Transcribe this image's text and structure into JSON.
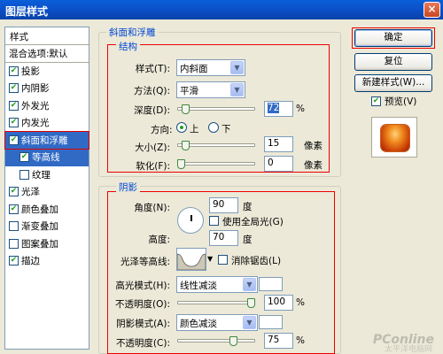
{
  "window": {
    "title": "图层样式",
    "close_glyph": "×"
  },
  "left_panel": {
    "header": "样式",
    "blend_item": "混合选项:默认",
    "items": [
      {
        "label": "投影",
        "checked": true
      },
      {
        "label": "内阴影",
        "checked": true
      },
      {
        "label": "外发光",
        "checked": true
      },
      {
        "label": "内发光",
        "checked": true
      },
      {
        "label": "斜面和浮雕",
        "checked": true,
        "selected": true
      },
      {
        "label": "等高线",
        "checked": true,
        "sub": true
      },
      {
        "label": "纹理",
        "checked": false,
        "sub": true
      },
      {
        "label": "光泽",
        "checked": true
      },
      {
        "label": "颜色叠加",
        "checked": true
      },
      {
        "label": "渐变叠加",
        "checked": false
      },
      {
        "label": "图案叠加",
        "checked": false
      },
      {
        "label": "描边",
        "checked": true
      }
    ]
  },
  "bevel": {
    "group_title": "斜面和浮雕",
    "structure_title": "结构",
    "style_label": "样式(T):",
    "style_value": "内斜面",
    "technique_label": "方法(Q):",
    "technique_value": "平滑",
    "depth_label": "深度(D):",
    "depth_value": "72",
    "depth_unit": "%",
    "direction_label": "方向:",
    "direction_up": "上",
    "direction_down": "下",
    "size_label": "大小(Z):",
    "size_value": "15",
    "size_unit": "像素",
    "soften_label": "软化(F):",
    "soften_value": "0",
    "soften_unit": "像素",
    "depth_level": 0.06,
    "size_level": 0.06,
    "soften_level": 0.0
  },
  "shading": {
    "group_title": "阴影",
    "angle_label": "角度(N):",
    "angle_value": "90",
    "angle_unit": "度",
    "global_light_label": "使用全局光(G)",
    "altitude_label": "高度:",
    "altitude_value": "70",
    "altitude_unit": "度",
    "gloss_label": "光泽等高线:",
    "antialias_label": "消除锯齿(L)",
    "highlight_mode_label": "高光模式(H):",
    "highlight_mode_value": "线性减淡",
    "highlight_opacity_label": "不透明度(O):",
    "highlight_opacity_value": "100",
    "highlight_opacity_unit": "%",
    "shadow_mode_label": "阴影模式(A):",
    "shadow_mode_value": "颜色减淡",
    "shadow_opacity_label": "不透明度(C):",
    "shadow_opacity_value": "75",
    "shadow_opacity_unit": "%",
    "highlight_opacity_level": 1.0,
    "shadow_opacity_level": 0.75
  },
  "buttons": {
    "ok": "确定",
    "reset": "复位",
    "new_style": "新建样式(W)...",
    "preview_label": "预览(V)"
  },
  "watermark": {
    "brand": "PConline",
    "sub": "太平洋电脑网"
  },
  "colors": {
    "accent": "#316ac5",
    "highlight_red": "#e00000",
    "title_blue": "#0046d5"
  }
}
